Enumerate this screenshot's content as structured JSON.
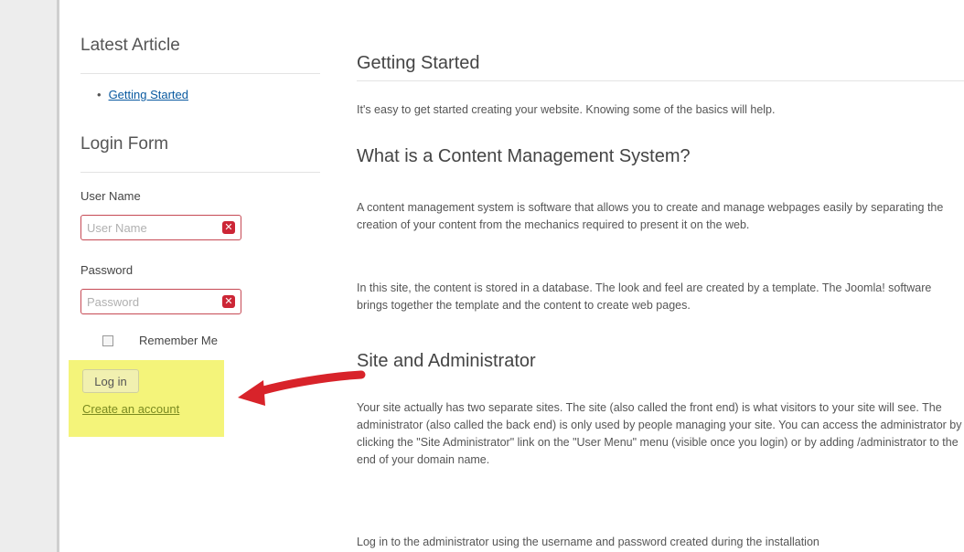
{
  "sidebar": {
    "latest_title": "Latest Article",
    "latest_items": [
      "Getting Started"
    ],
    "login_title": "Login Form",
    "username_label": "User Name",
    "username_placeholder": "User Name",
    "password_label": "Password",
    "password_placeholder": "Password",
    "remember_label": "Remember Me",
    "login_button": "Log in",
    "create_account": "Create an account"
  },
  "main": {
    "title": "Getting Started",
    "intro": "It's easy to get started creating your website. Knowing some of the basics will help.",
    "h_cms": "What is a Content Management System?",
    "p_cms": "A content management system is software that allows you to create and manage webpages easily by separating the creation of your content from the mechanics required to present it on the web.",
    "p_db": "In this site, the content is stored in a database. The look and feel are created by a template. The Joomla! software brings together the template and the content to create web pages.",
    "h_site": "Site and Administrator",
    "p_site": "Your site actually has two separate sites. The site (also called the front end) is what visitors to your site will see. The administrator (also called the back end) is only used by people managing your site. You can access the administrator by clicking the \"Site Administrator\" link on the \"User Menu\" menu (visible once you login) or by adding /administrator to the end of your domain name.",
    "p_login": "Log in to the administrator using the username and password created during the installation"
  },
  "colors": {
    "highlight": "#f4f47a",
    "arrow": "#d8232a",
    "input_border": "#c64a55"
  }
}
